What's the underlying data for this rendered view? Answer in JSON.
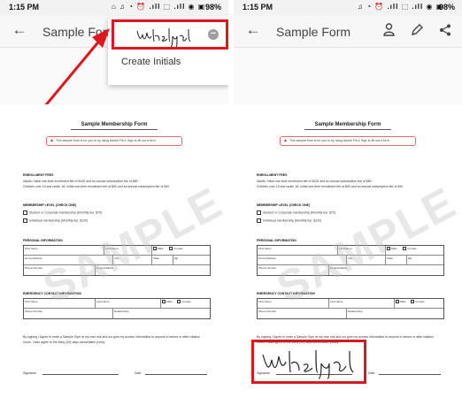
{
  "status_left": {
    "time": "1:15 PM",
    "icons": "⌂ ♫ ◔ ⏰ .ıll ⬚ .ıll ◉ ▣",
    "battery": "98%"
  },
  "status_right": {
    "time": "1:15 PM",
    "icons": "♫ ◔ ⏰ .ıll ⬚ .ıll ◉ ▣",
    "battery": "98%"
  },
  "app": {
    "title": "Sample Form"
  },
  "dropdown": {
    "create_initials": "Create Initials"
  },
  "doc": {
    "title": "Sample Membership Form",
    "notice": "This sample form is for you to try using Adobe Fill & Sign to fill out a form.",
    "enrollment": {
      "heading": "ENROLLMENT FEES",
      "line1": "Adults: Initial one-time enrollment fee of $100 and an annual subscription fee of $80",
      "line2": "Children over 10 and under 18: Initial one-time enrollment fee of $50 and an annual subscription fee of $40"
    },
    "membership": {
      "heading": "MEMBERSHIP LEVEL (CHECK ONE)",
      "option1": "Student or Corporate membership (Monthly fee: $75)",
      "option2": "Individual membership (Monthly fee: $120)"
    },
    "personal": {
      "heading": "PERSONAL INFORMATION",
      "first_name": "First Name",
      "last_name": "Last Name",
      "male": "Male",
      "female": "Female",
      "home_address": "Home Address",
      "city": "City",
      "state": "State",
      "zip": "Zip",
      "phone": "Phone Number",
      "email": "Email Address"
    },
    "emergency": {
      "heading": "EMERGENCY CONTACT INFORMATION",
      "first_name": "First Name",
      "last_name": "Last Name",
      "male": "Male",
      "female": "Female",
      "phone": "Phone Number",
      "relationship": "Relationship"
    },
    "watermark": "SAMPLE",
    "agreement": "By signing I Agree to enter a Sample Gym at my own risk and not give my access information to anyone in before or after rotation hours. I also agree to the thirty (30) days cancellation policy.",
    "signature_label": "Signature",
    "date_label": "Date"
  },
  "colors": {
    "highlight": "#e0161e",
    "appbar": "#f7f7f7"
  },
  "icons": [
    "back-arrow-icon",
    "remove-icon",
    "person-icon",
    "pen-icon",
    "share-icon",
    "warning-icon"
  ]
}
